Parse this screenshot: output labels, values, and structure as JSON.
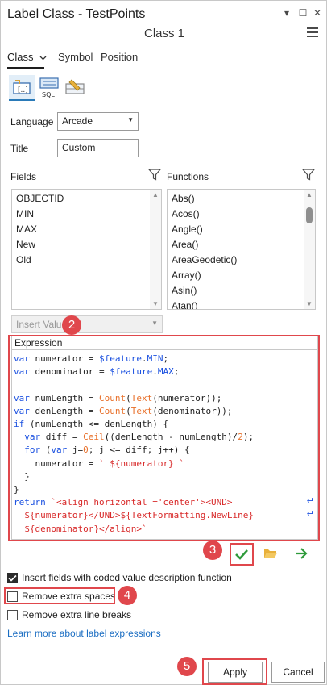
{
  "window": {
    "title": "Label Class - TestPoints",
    "subtitle": "Class 1",
    "close_glyph": "✕",
    "minimize_glyph": "▾",
    "maximize_glyph": "☐"
  },
  "tabs": [
    {
      "label": "Class"
    },
    {
      "label": "Symbol"
    },
    {
      "label": "Position"
    }
  ],
  "form": {
    "language_label": "Language",
    "language_value": "Arcade",
    "title_label": "Title",
    "title_value": "Custom",
    "fields_label": "Fields",
    "functions_label": "Functions",
    "insert_values_label": "Insert Values",
    "expression_label": "Expression"
  },
  "fields_list": [
    "OBJECTID",
    "MIN",
    "MAX",
    "New",
    "Old"
  ],
  "functions_list": [
    "Abs()",
    "Acos()",
    "Angle()",
    "Area()",
    "AreaGeodetic()",
    "Array()",
    "Asin()",
    "Atan()"
  ],
  "options": {
    "coded_values_label": "Insert fields with coded value description function",
    "coded_values_checked": true,
    "remove_spaces_label": "Remove extra spaces",
    "remove_spaces_checked": false,
    "remove_breaks_label": "Remove extra line breaks",
    "remove_breaks_checked": false,
    "learn_more_link": "Learn more about label expressions"
  },
  "buttons": {
    "apply": "Apply",
    "cancel": "Cancel"
  },
  "annotations": {
    "expression": "2",
    "verify": "3",
    "remove_spaces": "4",
    "apply": "5"
  },
  "colors": {
    "accent_red": "#e0474c",
    "keyword_blue": "#1a50e0",
    "function_orange": "#e8702a",
    "check_green": "#2e9a3a"
  }
}
